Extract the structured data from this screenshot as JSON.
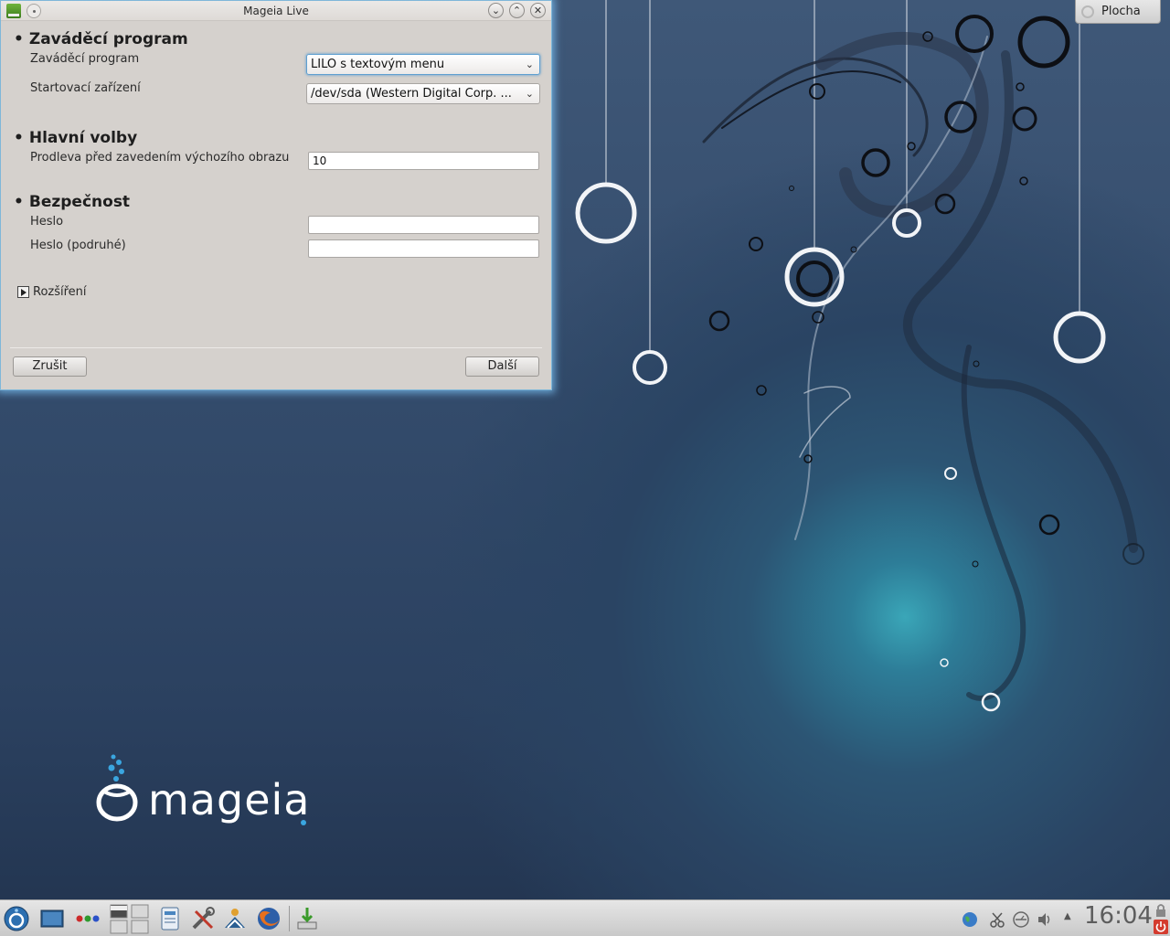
{
  "window": {
    "title": "Mageia Live",
    "controls": [
      "minimize",
      "maximize",
      "close"
    ]
  },
  "sections": {
    "bootloader": {
      "title": "Zaváděcí program",
      "loader_label": "Zaváděcí program",
      "loader_value": "LILO s textovým menu",
      "device_label": "Startovací zařízení",
      "device_value": "/dev/sda (Western Digital Corp. ..."
    },
    "main": {
      "title": "Hlavní volby",
      "delay_label": "Prodleva před zavedením výchozího obrazu",
      "delay_value": "10"
    },
    "security": {
      "title": "Bezpečnost",
      "password_label": "Heslo",
      "password_value": "",
      "password2_label": "Heslo (podruhé)",
      "password2_value": ""
    }
  },
  "advanced": {
    "label": "Rozšíření"
  },
  "buttons": {
    "cancel": "Zrušit",
    "next": "Další"
  },
  "desktop": {
    "plocha_label": "Plocha",
    "logo_text": "mageia"
  },
  "taskbar": {
    "clock": "16:04",
    "launchers": [
      "application-menu-icon",
      "desktop-show-icon",
      "color-dots-icon",
      "pager-icon",
      "document-icon",
      "tools-icon",
      "installer-person-icon",
      "firefox-icon",
      "install-task-icon"
    ],
    "tray": [
      "network-globe-icon",
      "clipboard-scissors-icon",
      "usb-icon",
      "volume-icon",
      "expand-tray-icon",
      "lock-icon",
      "power-icon"
    ]
  }
}
